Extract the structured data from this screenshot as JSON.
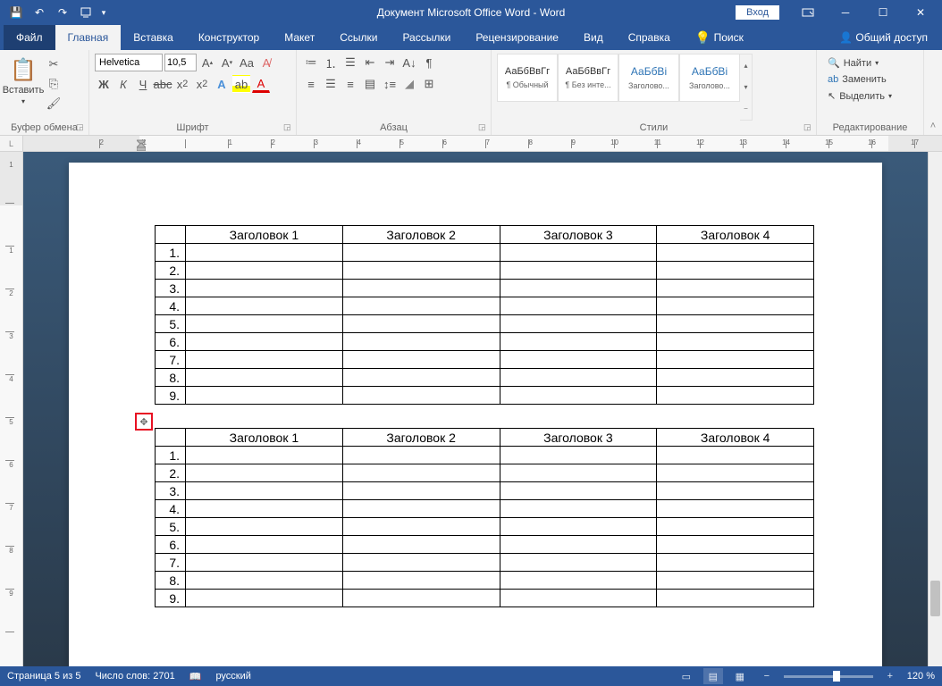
{
  "title": "Документ Microsoft Office Word  -  Word",
  "login": "Вход",
  "tabs": {
    "file": "Файл",
    "home": "Главная",
    "insert": "Вставка",
    "design": "Конструктор",
    "layout": "Макет",
    "refs": "Ссылки",
    "mail": "Рассылки",
    "review": "Рецензирование",
    "view": "Вид",
    "help": "Справка",
    "tell": "Поиск",
    "share": "Общий доступ"
  },
  "ribbon": {
    "clipboard": {
      "paste": "Вставить",
      "label": "Буфер обмена"
    },
    "font": {
      "name": "Helvetica",
      "size": "10,5",
      "label": "Шрифт",
      "bold": "Ж",
      "italic": "К",
      "underline": "Ч"
    },
    "para": {
      "label": "Абзац"
    },
    "styles": {
      "label": "Стили",
      "preview": "АаБбВвГг",
      "previewH": "АаБбВі",
      "items": [
        "¶ Обычный",
        "¶ Без инте...",
        "Заголово...",
        "Заголово..."
      ]
    },
    "editing": {
      "label": "Редактирование",
      "find": "Найти",
      "replace": "Заменить",
      "select": "Выделить"
    }
  },
  "ruler_corner": "L",
  "ruler_nums": [
    "2",
    "1",
    "",
    "1",
    "2",
    "3",
    "4",
    "5",
    "6",
    "7",
    "8",
    "9",
    "10",
    "11",
    "12",
    "13",
    "14",
    "15",
    "16",
    "17"
  ],
  "vruler_nums": [
    "1",
    "",
    "1",
    "2",
    "3",
    "4",
    "5",
    "6",
    "7",
    "8",
    "9"
  ],
  "table": {
    "headers": [
      "Заголовок 1",
      "Заголовок 2",
      "Заголовок 3",
      "Заголовок 4"
    ],
    "rows": [
      "1.",
      "2.",
      "3.",
      "4.",
      "5.",
      "6.",
      "7.",
      "8.",
      "9."
    ]
  },
  "status": {
    "page": "Страница 5 из 5",
    "words": "Число слов: 2701",
    "lang": "русский",
    "zoom": "120 %"
  }
}
